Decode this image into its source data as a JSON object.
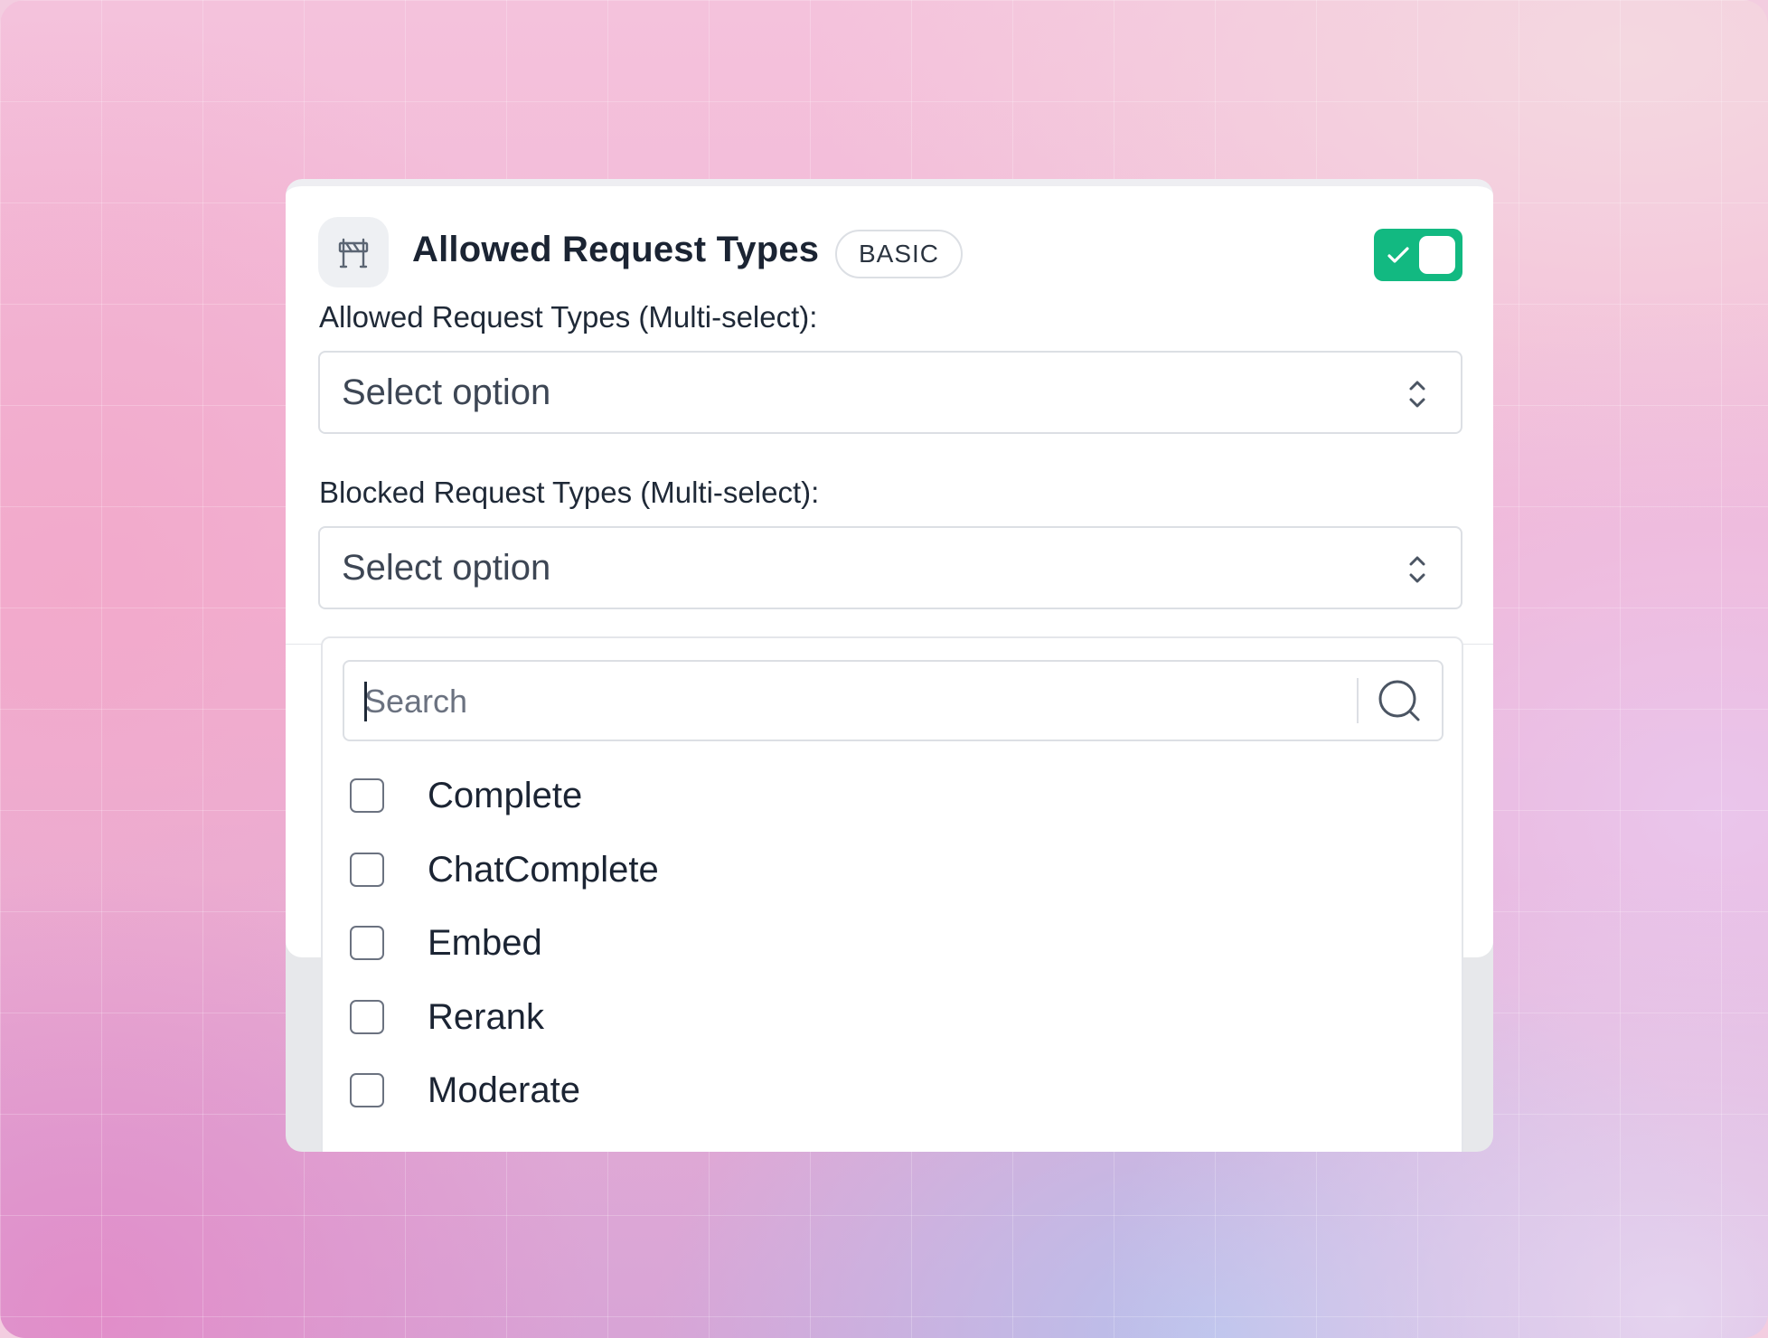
{
  "plugin": {
    "icon": "barrier-icon",
    "title": "Allowed Request Types",
    "badge": "BASIC",
    "enabled": true,
    "accent_color": "#12b981"
  },
  "fields": {
    "allowed": {
      "label": "Allowed Request Types (Multi-select):",
      "placeholder": "Select option"
    },
    "blocked": {
      "label": "Blocked Request Types (Multi-select):",
      "placeholder": "Select option"
    }
  },
  "dropdown": {
    "search_placeholder": "Search",
    "options": [
      {
        "label": "Complete",
        "checked": false
      },
      {
        "label": "ChatComplete",
        "checked": false
      },
      {
        "label": "Embed",
        "checked": false
      },
      {
        "label": "Rerank",
        "checked": false
      },
      {
        "label": "Moderate",
        "checked": false
      }
    ]
  }
}
